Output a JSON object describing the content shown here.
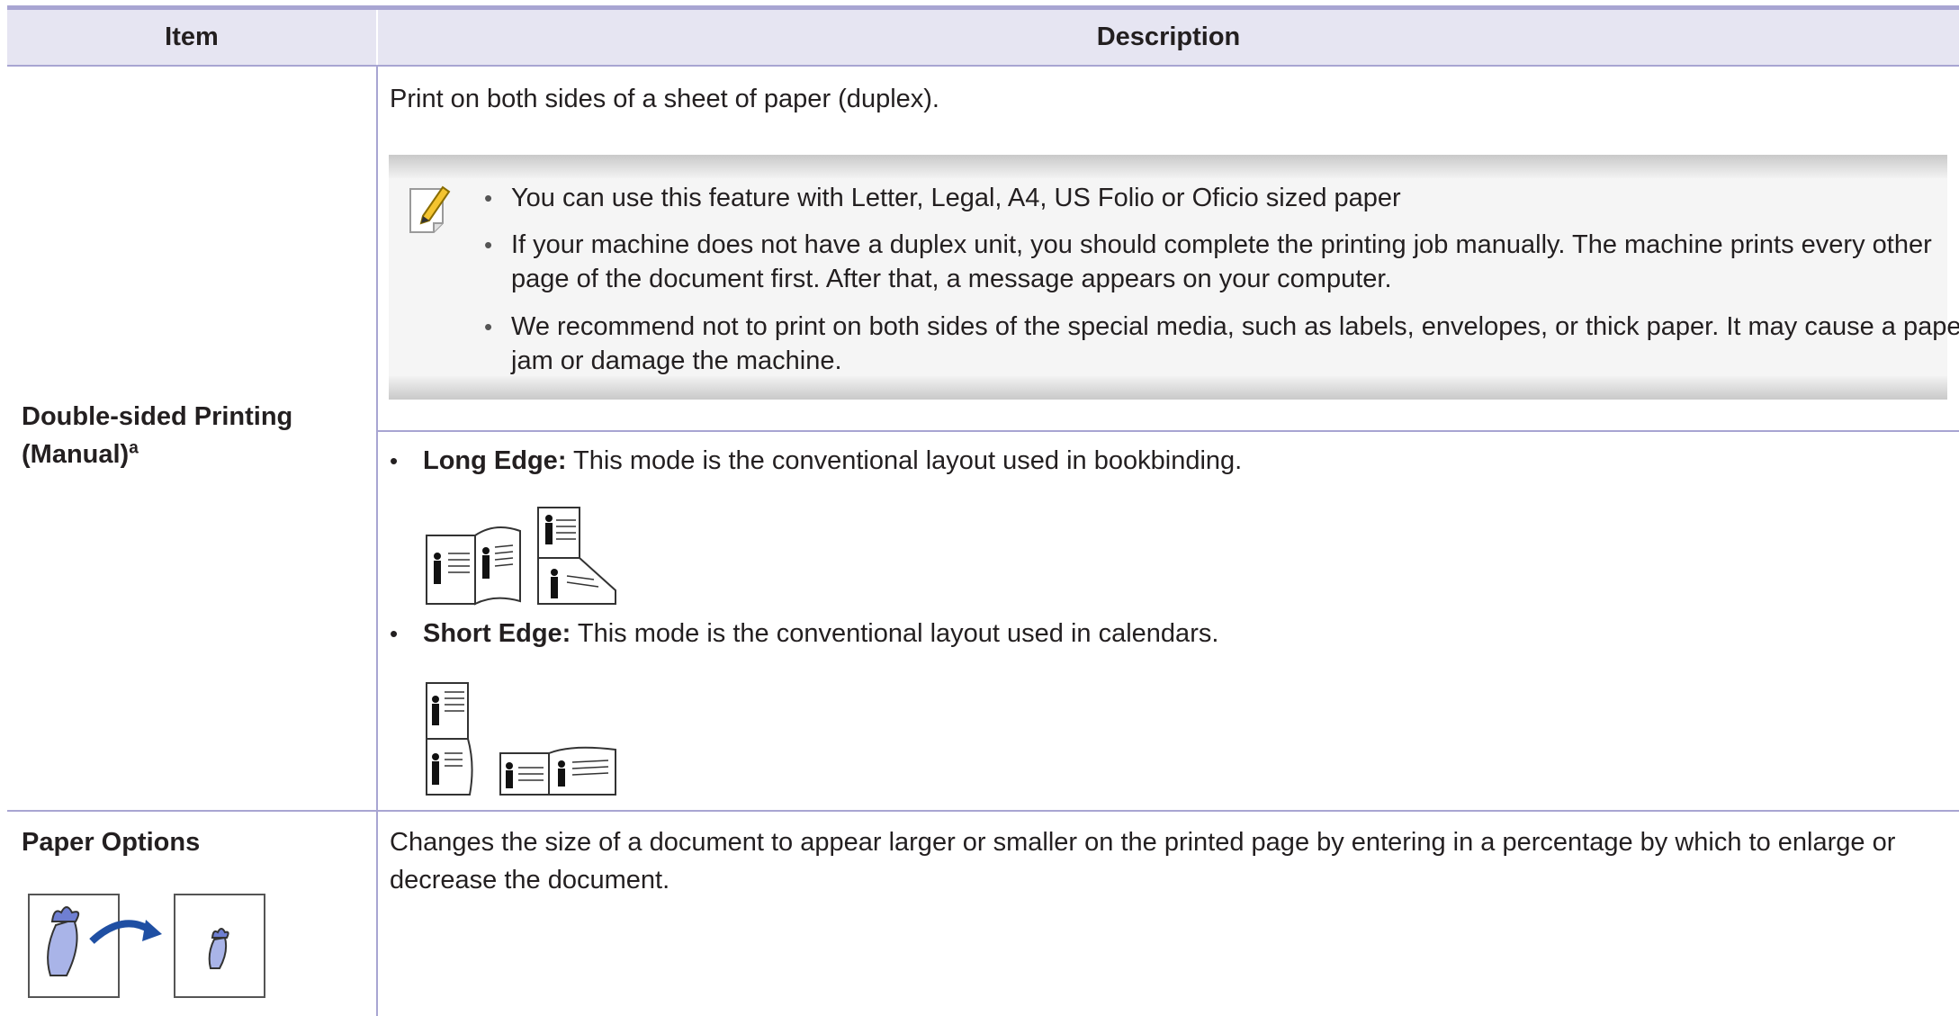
{
  "header": {
    "item": "Item",
    "description": "Description"
  },
  "row1": {
    "item_label": "Double-sided Printing",
    "item_label_line2": "(Manual)",
    "item_sup": "a",
    "intro": "Print on both sides of a sheet of paper (duplex).",
    "notes": [
      {
        "line1": "You can use this feature with Letter, Legal, A4, US Folio or Oficio sized paper"
      },
      {
        "line1": "If your machine does not have a duplex unit, you should complete the printing job manually. The machine prints every other",
        "line2": "page of the document first. After that, a message appears on your computer."
      },
      {
        "line1": "We recommend not to print on both sides of the special media, such as labels, envelopes, or thick paper. It may cause a paper",
        "line2": "jam or damage the machine."
      }
    ],
    "long_edge": {
      "term": "Long Edge:",
      "text": " This mode is the conventional layout used in bookbinding."
    },
    "short_edge": {
      "term": "Short Edge:",
      "text": " This mode is the conventional layout used in calendars."
    },
    "icons": [
      "note-pencil-icon",
      "long-edge-layout-icon",
      "short-edge-layout-icon"
    ]
  },
  "row2": {
    "item_label": "Paper Options",
    "desc_line1": "Changes the size of a document to appear larger or smaller on the printed page by entering in a percentage by which to enlarge or",
    "desc_line2": "decrease the document.",
    "icons": [
      "reduce-enlarge-icon"
    ]
  },
  "colors": {
    "rule": "#a8a5d2",
    "header_bg": "#e6e5f2",
    "text": "#231f20",
    "note_bg": "#f5f5f5"
  }
}
